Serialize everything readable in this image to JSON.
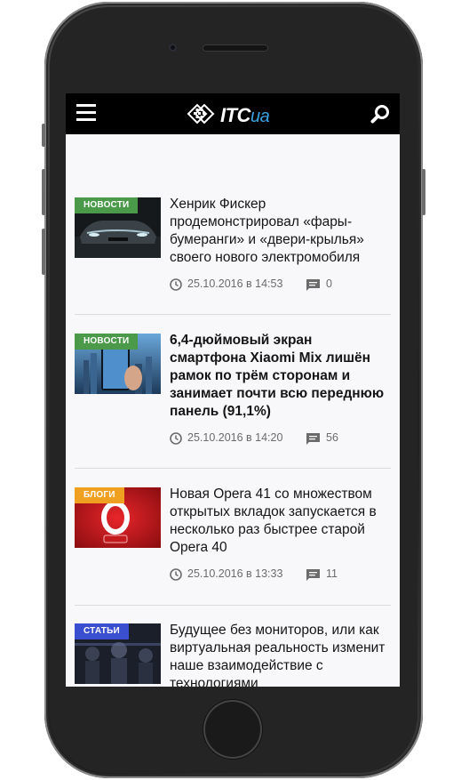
{
  "header": {
    "logo_main": "ITC",
    "logo_accent": "ua"
  },
  "articles": [
    {
      "category": "НОВОСТИ",
      "category_color": "#4a9a4a",
      "title": "Хенрик Фискер продемонстрировал «фары-бумеранги» и «двери-крылья» своего нового электромобиля",
      "bold": false,
      "date": "25.10.2016 в 14:53",
      "comments": "0"
    },
    {
      "category": "НОВОСТИ",
      "category_color": "#4a9a4a",
      "title": "6,4-дюймовый экран смартфона Xiaomi Mix лишён рамок по трём сторонам и занимает почти всю переднюю панель (91,1%)",
      "bold": true,
      "date": "25.10.2016 в 14:20",
      "comments": "56"
    },
    {
      "category": "БЛОГИ",
      "category_color": "#f0a020",
      "title": "Новая Opera 41 со множеством открытых вкладок запускается в несколько раз быстрее старой Opera 40",
      "bold": false,
      "date": "25.10.2016 в 13:33",
      "comments": "11"
    },
    {
      "category": "СТАТЬИ",
      "category_color": "#3a4fd0",
      "title": "Будущее без мониторов, или как виртуальная реальность изменит наше взаимодействие с технологиями",
      "bold": false
    }
  ]
}
